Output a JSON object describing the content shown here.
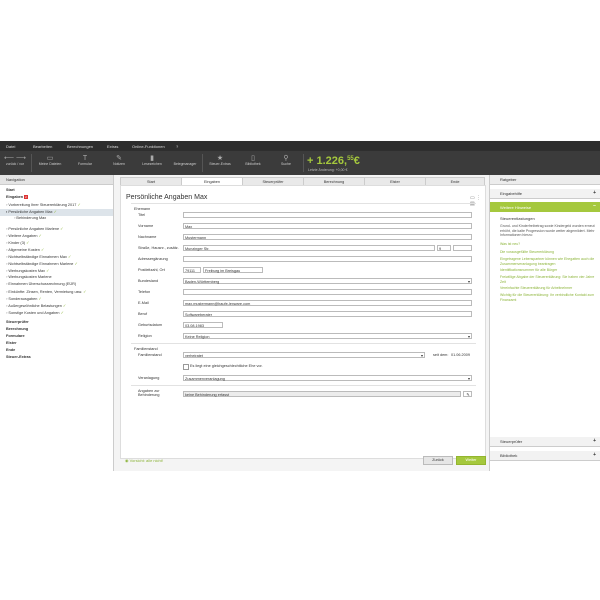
{
  "menu": [
    "Datei",
    "Bearbeiten",
    "Berechnungen",
    "Extras",
    "Online-Funktionen",
    "?"
  ],
  "toolbar": {
    "back": "zurück",
    "forward": "vor",
    "items": [
      {
        "label": "Meine Dateien",
        "icon": "folder-icon"
      },
      {
        "label": "Formular",
        "icon": "form-icon"
      },
      {
        "label": "Notizen",
        "icon": "pencil-icon"
      },
      {
        "label": "Lesezeichen",
        "icon": "bookmark-icon"
      },
      {
        "label": "Belegmanager",
        "icon": "document-icon"
      },
      {
        "label": "Steuer-Extras",
        "icon": "star-icon"
      },
      {
        "label": "Bibliothek",
        "icon": "book-icon"
      },
      {
        "label": "Suche",
        "icon": "search-icon"
      }
    ],
    "refund_main": "+ 1.226,",
    "refund_cents": "55",
    "refund_currency": "€",
    "refund_change": "Letzte Änderung: +0,00 €"
  },
  "nav": {
    "header": "Navigation",
    "items": [
      {
        "label": "Start",
        "bold": true
      },
      {
        "label": "Eingaben",
        "bold": true,
        "badge": "2"
      },
      {
        "label": "Vorbereitung Ihrer Steuererklärung 2017",
        "check": true
      },
      {
        "label": "Persönliche Angaben Max",
        "check": true,
        "selected": true
      },
      {
        "label": "Behinderung Max"
      },
      {
        "label": "Persönliche Angaben Marlene",
        "check": true
      },
      {
        "label": "Weitere Angaben",
        "check": true
      },
      {
        "label": "Kinder (3)",
        "check": true
      },
      {
        "label": "Allgemeine Kosten",
        "check": true
      },
      {
        "label": "Nichtselbständige Einnahmen Max",
        "check": true
      },
      {
        "label": "Nichtselbständige Einnahmen Marlene",
        "check": true
      },
      {
        "label": "Werbungskosten Max",
        "check": true
      },
      {
        "label": "Werbungskosten Marlene"
      },
      {
        "label": "Einnahmen Überschussrechnung (EÜR)"
      },
      {
        "label": "Einkünfte: Zinsen, Renten, Vermietung usw.",
        "check": true
      },
      {
        "label": "Sonderausgaben",
        "check": true
      },
      {
        "label": "Außergewöhnliche Belastungen",
        "check": true
      },
      {
        "label": "Sonstige Kosten und Angaben",
        "check": true
      },
      {
        "label": "Steuerprüfer",
        "bold": true
      },
      {
        "label": "Berechnung",
        "bold": true
      },
      {
        "label": "Formulare",
        "bold": true
      },
      {
        "label": "Elster",
        "bold": true
      },
      {
        "label": "Ende",
        "bold": true
      },
      {
        "label": "Steuer-Extras",
        "bold": true
      }
    ]
  },
  "tabs": [
    "Start",
    "Eingaben",
    "Steuerprüfer",
    "Berechnung",
    "Elster",
    "Ende"
  ],
  "form": {
    "title": "Persönliche Angaben Max",
    "section_name": "Ehemann",
    "fields": {
      "titel_label": "Titel",
      "titel": "",
      "vorname_label": "Vorname",
      "vorname": "Max",
      "nachname_label": "Nachname",
      "nachname": "Mustermann",
      "strasse_label": "Straße, Hausnr., zusätz.",
      "strasse": "Munzinger Str.",
      "hausnr": "9",
      "adress_label": "Adressergänzung",
      "adress": "",
      "plz_label": "Postleitzahl, Ort",
      "plz": "79111",
      "ort": "Freiburg im Breisgau",
      "bundesland_label": "Bundesland",
      "bundesland": "Baden-Württemberg",
      "telefon_label": "Telefon",
      "telefon": "",
      "email_label": "E-Mail",
      "email": "max.mustermann@haufe-lexware.com",
      "beruf_label": "Beruf",
      "beruf": "Softwareberater",
      "geburt_label": "Geburtsdatum",
      "geburt": "03.08.1983",
      "religion_label": "Religion",
      "religion": "Keine Religion"
    },
    "section_family": "Familienstand",
    "familienstand_label": "Familienstand",
    "familienstand": "verheiratet",
    "seit_label": "seit dem:",
    "seit": "01.06.2009",
    "lebenspartner": "Es liegt eine gleichgeschlechtliche Ehe vor.",
    "veranlagung_label": "Veranlagung",
    "veranlagung": "Zusammenveranlagung",
    "behinderung_label": "Angaben zur Behinderung",
    "behinderung": "keine Behinderung erfasst",
    "hint": "Vorsicht: alle nicht!",
    "btn_back": "Zurück",
    "btn_next": "Weiter"
  },
  "right": {
    "header": "Ratgeber",
    "eingabehilfe": "Eingabehilfe",
    "weitere": "Weitere Hinweise",
    "steuer_title": "Steuerentlastungen",
    "steuer_text": "Grund- und Kinderfreibetrag sowie Kindergeld wurden erneut erhöht, die kalte Progression wurde weiter abgemildert. Mehr Informationen hierzu:",
    "steuer_link": "Was ist neu?",
    "links": [
      "Die vorausgefüllte Steuererklärung",
      "Eingetragene Lebenspartner können wie Ehegatten auch die Zusammenveranlagung beantragen",
      "Identifikationsnummer für alle Bürger",
      "Freiwillige Abgabe der Steuererklärung: Sie haben vier Jahre Zeit",
      "Vereinfachte Steuererklärung für Arbeitnehmer",
      "Wichtig für die Steuererklärung: Ihr verbindliche Kontakt zum Finanzamt"
    ],
    "steuerpruefer": "Steuerprüfer",
    "bibliothek": "Bibliothek"
  }
}
